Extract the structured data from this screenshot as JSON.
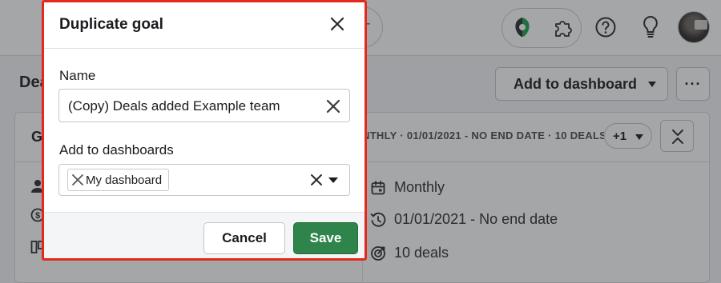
{
  "background": {
    "page_title": "Dea",
    "add_to_dashboard_label": "Add to dashboard",
    "more_label": "···",
    "card_title_fragment": "G",
    "card_meta": "NTHLY  ·  01/01/2021 - NO END DATE  ·  10 DEALS",
    "plus_badge": "+1",
    "info": {
      "period": "Monthly",
      "dates": "01/01/2021 - No end date",
      "target": "10 deals"
    },
    "topbar_pill_glyph": "+",
    "icons": [
      "app-logo-icon",
      "puzzle-icon",
      "help-icon",
      "lightbulb-icon",
      "avatar"
    ]
  },
  "modal": {
    "title": "Duplicate goal",
    "name_label": "Name",
    "name_value": "(Copy) Deals added Example team",
    "dashboards_label": "Add to dashboards",
    "selected_dashboards": [
      "My dashboard"
    ],
    "cancel_label": "Cancel",
    "save_label": "Save"
  },
  "colors": {
    "highlight_border": "#e4291c",
    "save_green": "#2e844a",
    "overlay": "rgba(40,42,48,0.42)"
  }
}
